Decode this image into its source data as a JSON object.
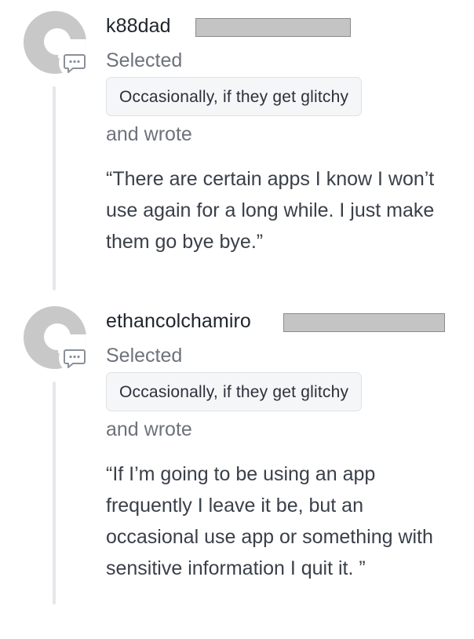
{
  "responses": [
    {
      "username": "k88dad",
      "selected_label": "Selected",
      "choice": "Occasionally, if they get glitchy",
      "wrote_label": "and wrote",
      "quote": "“There are certain apps I know I won’t use again for a long while. I just make them go bye bye.”"
    },
    {
      "username": "ethancolchamiro",
      "selected_label": "Selected",
      "choice": "Occasionally, if they get glitchy",
      "wrote_label": "and wrote",
      "quote": "“If I’m going to be using an app frequently I leave it be, but an occasional use app or something with sensitive information I quit it. ”"
    }
  ],
  "icons": {
    "avatar": "default-avatar-icon",
    "comment_badge": "comment-bubble-icon"
  },
  "colors": {
    "avatar_gray": "#c8c8c8",
    "thread_line": "#e5e7ea",
    "chip_background": "#f5f6f7",
    "chip_border": "#dfe2e5",
    "muted_text": "#6d727b",
    "redaction_fill": "#c4c4c4"
  }
}
